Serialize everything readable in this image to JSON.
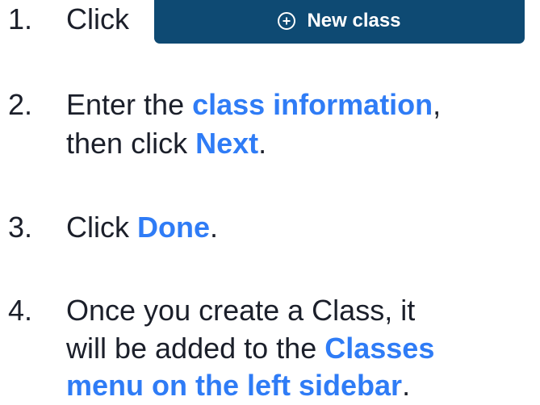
{
  "colors": {
    "text": "#1b1f2a",
    "highlight": "#2f7cf6",
    "button_bg": "#0e4a73",
    "button_text": "#ffffff"
  },
  "button": {
    "icon": "plus-circle-icon",
    "label": "New class"
  },
  "steps": [
    {
      "number": "1.",
      "text_before": "Click"
    },
    {
      "number": "2.",
      "text_before": "Enter the ",
      "highlight": "class information",
      "text_after": ",",
      "line2_before": "then click ",
      "line2_highlight": "Next",
      "line2_after": "."
    },
    {
      "number": "3.",
      "text_before": "Click ",
      "highlight": "Done",
      "text_after": "."
    },
    {
      "number": "4.",
      "text_before": "Once you create a Class, it",
      "line2_before": "will be added to the ",
      "line2_highlight": "Classes",
      "line3_highlight": "menu on the left sidebar",
      "line3_after": "."
    }
  ]
}
